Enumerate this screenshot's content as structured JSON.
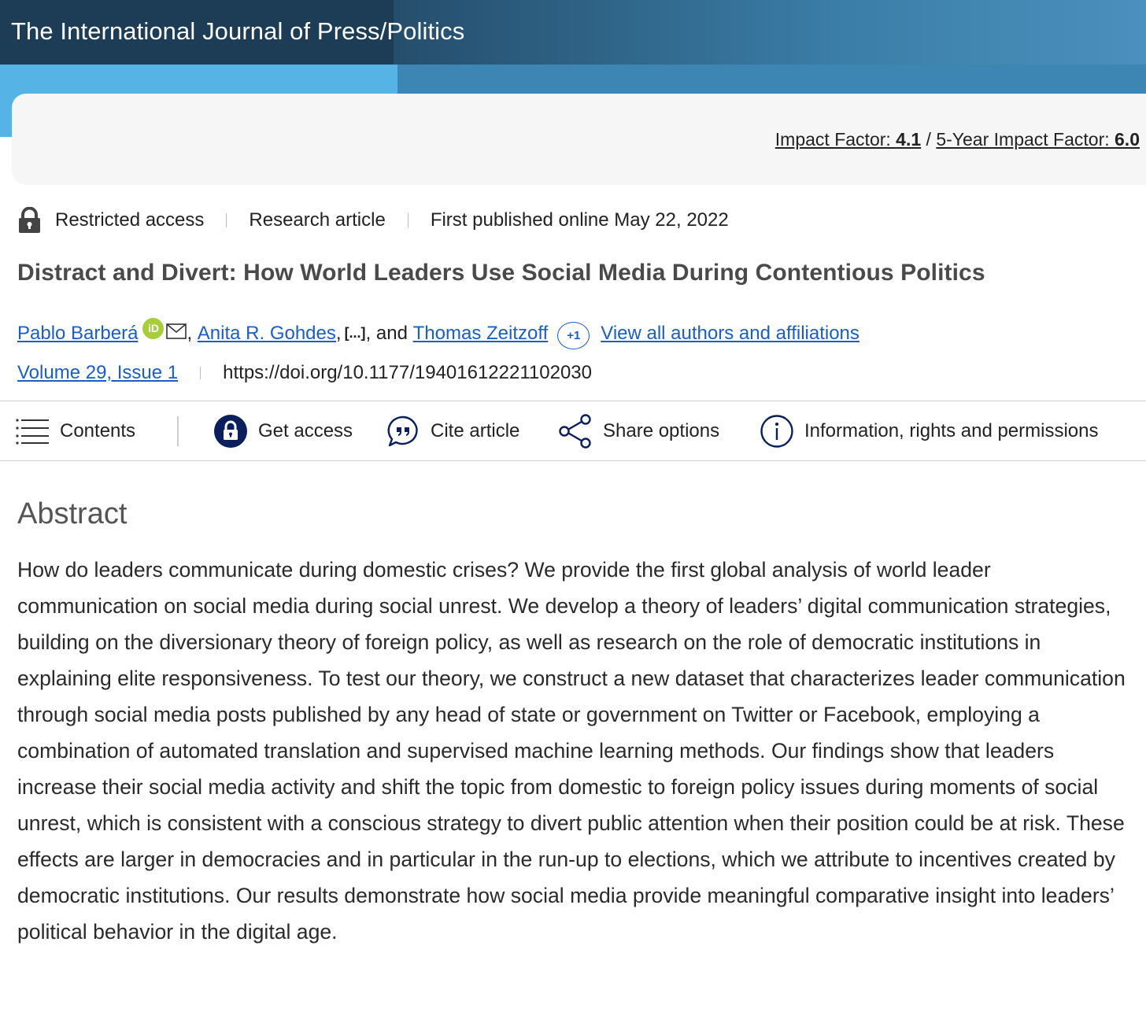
{
  "journal": {
    "title": "The International Journal of Press/Politics"
  },
  "metrics": {
    "impact_label": "Impact Factor: ",
    "impact_value": "4.1",
    "separator": "/",
    "five_year_label": "5-Year Impact Factor: ",
    "five_year_value": "6.0"
  },
  "meta": {
    "access": "Restricted access",
    "type": "Research article",
    "published": "First published online May 22, 2022"
  },
  "article": {
    "title": "Distract and Divert: How World Leaders Use Social Media During Contentious Politics"
  },
  "authors": {
    "first": "Pablo Barberá",
    "orcid": "iD",
    "second": "Anita R. Gohdes",
    "ellipsis": "[...]",
    "and": ", and",
    "third": "Thomas Zeitzoff",
    "more_count": "+1",
    "view_all": "View all authors and affiliations"
  },
  "citation": {
    "volume": "Volume 29, Issue 1",
    "doi": "https://doi.org/10.1177/19401612221102030"
  },
  "toolbar": {
    "contents": "Contents",
    "get_access": "Get access",
    "cite": "Cite article",
    "share": "Share options",
    "info": "Information, rights and permissions"
  },
  "abstract": {
    "heading": "Abstract",
    "text": "How do leaders communicate during domestic crises? We provide the first global analysis of world leader communication on social media during social unrest. We develop a theory of leaders’ digital communication strategies, building on the diversionary theory of foreign policy, as well as research on the role of democratic institutions in explaining elite responsiveness. To test our theory, we construct a new dataset that characterizes leader communication through social media posts published by any head of state or government on Twitter or Facebook, employing a combination of automated translation and supervised machine learning methods. Our findings show that leaders increase their social media activity and shift the topic from domestic to foreign policy issues during moments of social unrest, which is consistent with a conscious strategy to divert public attention when their position could be at risk. These effects are larger in democracies and in particular in the run-up to elections, which we attribute to incentives created by democratic institutions. Our results demonstrate how social media provide meaningful comparative insight into leaders’ political behavior in the digital age."
  },
  "colors": {
    "banner_dark": "#1d3d57",
    "banner_light": "#55b3e5",
    "link": "#1a5ec6",
    "orcid": "#a6ce39",
    "icon_navy": "#0a1f5c"
  }
}
